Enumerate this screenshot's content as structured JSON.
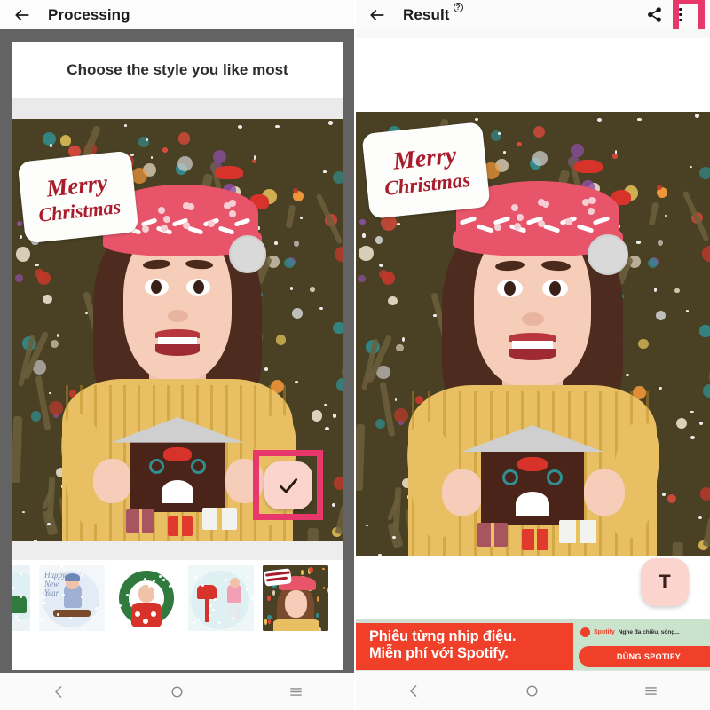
{
  "left_panel": {
    "appbar": {
      "back_icon": "arrow-left-icon",
      "title": "Processing"
    },
    "card": {
      "heading": "Choose the style you like most"
    },
    "artwork": {
      "banner_line1": "Merry",
      "banner_line2": "Christmas",
      "bg_color": "#4a4024",
      "hat_color": "#e8556b",
      "sweater_color": "#e8bf62"
    },
    "confirm_button": {
      "icon": "check-icon",
      "label": "",
      "bg_color": "#fbd4ce",
      "annotation_color": "#e8376a"
    },
    "thumbnails": [
      {
        "name": "style-snowglobe",
        "label": "",
        "bg": "#eaf3f6",
        "selected": false
      },
      {
        "name": "style-happy-new-year",
        "label": "Happy New Year",
        "bg": "#f4f7fa",
        "selected": false
      },
      {
        "name": "style-wreath",
        "label": "",
        "bg": "#ffffff",
        "selected": false
      },
      {
        "name": "style-mailbox",
        "label": "",
        "bg": "#eef7f8",
        "selected": false
      },
      {
        "name": "style-merry-christmas",
        "label": "Merry Christmas",
        "bg": "#4a4024",
        "selected": true
      }
    ],
    "navbar": {
      "back": "nav-back-icon",
      "home": "nav-home-icon",
      "recents": "nav-recents-icon"
    }
  },
  "right_panel": {
    "appbar": {
      "back_icon": "arrow-left-icon",
      "title": "Result",
      "help_glyph": "?",
      "share_icon": "share-icon",
      "menu_icon": "overflow-menu-icon",
      "menu_annotation_color": "#e8376a"
    },
    "artwork": {
      "banner_line1": "Merry",
      "banner_line2": "Christmas",
      "bg_color": "#4a4024"
    },
    "text_button": {
      "label": "T",
      "bg_color": "#fbd4ce"
    },
    "ad": {
      "line1": "Phiêu từng nhịp điệu.",
      "line2": "Miễn phí với Spotify.",
      "brand": "Spotify",
      "tagline": "Nghe đa chiều, sống...",
      "cta": "DÙNG SPOTIFY",
      "bg_color": "#c9e3cd",
      "accent_color": "#f0402a"
    },
    "navbar": {
      "back": "nav-back-icon",
      "home": "nav-home-icon",
      "recents": "nav-recents-icon"
    }
  }
}
